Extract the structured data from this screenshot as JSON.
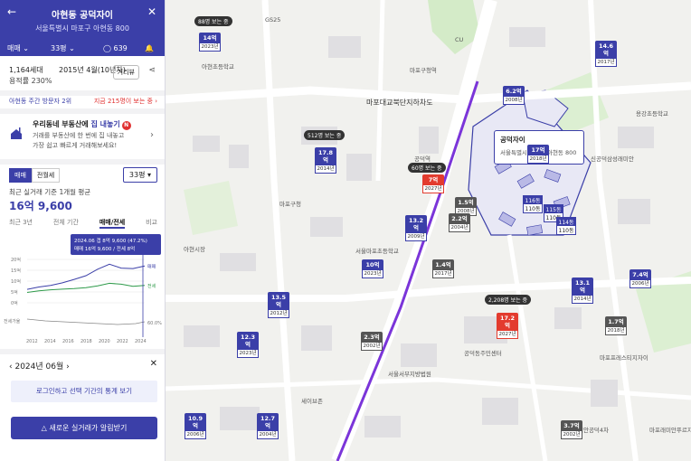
{
  "header": {
    "title": "아현동 공덕자이",
    "address": "서울특별시 마포구 아현동 800",
    "trade_type": "매매",
    "area": "33평",
    "comments": "639"
  },
  "summary": {
    "households": "1,164세대",
    "built": "2015년 4월(10년차)",
    "far": "용적률 230%",
    "distance_btn": "거리뷰"
  },
  "rank": {
    "left": "아현동 주간 방문자 2위",
    "right": "지금 215명이 보는 중 ›"
  },
  "promo": {
    "title_prefix": "우리동네 부동산에 ",
    "title_accent": "집 내놓기",
    "badge": "N",
    "line1": "거래를 부동산에 한 번에 집 내놓고",
    "line2": "가장 쉽고 빠르게 거래해보세요!"
  },
  "trade_tabs": [
    "매매",
    "전월세"
  ],
  "area_select": "33평 ▾",
  "avg_label": "최근 실거래 기준 1개월 평균",
  "avg_price": "16억 9,600",
  "period_tabs": [
    "최근 3년",
    "전체 기간",
    "매매/전세",
    "비교"
  ],
  "chart_data": {
    "type": "line",
    "tooltip_line1": "2024.06 갭 8억 9,600 (47.2%)",
    "tooltip_line2": "매매 16억 9,600 / 전세 8억",
    "y_ticks": [
      "20억",
      "15억",
      "10억",
      "5억",
      "0억"
    ],
    "volume_label": "전세가율",
    "x_ticks": [
      "2012",
      "2014",
      "2016",
      "2018",
      "2020",
      "2022",
      "2024"
    ],
    "series": [
      {
        "name": "매매",
        "values": [
          6.2,
          7.3,
          8.0,
          9.2,
          10.8,
          12.5,
          15.5,
          17.8,
          16.0,
          15.8,
          16.96
        ],
        "color": "#3b3fa8"
      },
      {
        "name": "전세",
        "values": [
          4.8,
          5.5,
          6.0,
          6.3,
          6.6,
          7.0,
          7.8,
          9.0,
          8.6,
          7.6,
          8.0
        ],
        "color": "#2e9a4a"
      }
    ],
    "ratio_label": "60.0%"
  },
  "month_nav": {
    "label": "2024년 06월",
    "prev": "‹",
    "next": "›",
    "close": "✕"
  },
  "login_text": "로그인하고 선택 기간의 통계 보기",
  "cta": "새로운 실거래가 알림받기",
  "map": {
    "main_card": {
      "name": "공덕자이",
      "address": "서울특별시 마포구 아현동 800"
    },
    "road_label": "마포대교북단지하차도",
    "labels": [
      "아현초등학교",
      "마포대교입구광장",
      "공덕역",
      "마포구청",
      "CU",
      "GS25",
      "서울마포초등학교",
      "아현시장",
      "마포구청역",
      "세이브존",
      "서울서부지방법원",
      "공덕동주민센터",
      "마포프레스티지자이",
      "래미안공덕4차",
      "마포래미안푸르지오",
      "신공덕삼성래미안",
      "용강초등학교",
      "공덕파크자이",
      "서울시립마포청소년센터"
    ],
    "pins": [
      {
        "price": "14억",
        "year": "2023년"
      },
      {
        "price": "6.2억",
        "year": "2008년"
      },
      {
        "price": "14.6억",
        "year": "2017년"
      },
      {
        "price": "17.8억",
        "year": "2014년"
      },
      {
        "price": "7억",
        "year": "2027년"
      },
      {
        "price": "1.5억",
        "year": "2008년"
      },
      {
        "price": "2.2억",
        "year": "2004년"
      },
      {
        "price": "13.2억",
        "year": "2009년"
      },
      {
        "price": "10억",
        "year": "2023년"
      },
      {
        "price": "1.4억",
        "year": "2017년"
      },
      {
        "price": "17억",
        "year": "2018년"
      },
      {
        "price": "13.5억",
        "year": "2012년"
      },
      {
        "price": "12.3억",
        "year": "2023년"
      },
      {
        "price": "17.2억",
        "year": "2027년"
      },
      {
        "price": "2.3억",
        "year": "2002년"
      },
      {
        "price": "13.1억",
        "year": "2014년"
      },
      {
        "price": "7.4억",
        "year": "2006년"
      },
      {
        "price": "1.7억",
        "year": "2018년"
      },
      {
        "price": "10.9억",
        "year": "2006년"
      },
      {
        "price": "12.7억",
        "year": "2004년"
      },
      {
        "price": "3.7억",
        "year": "2002년"
      }
    ],
    "bubbles": [
      "88명 보는 중",
      "512명 보는 중",
      "60명 보는 중",
      "2,208명 보는 중"
    ],
    "buildings": [
      {
        "dong": "116동",
        "v": "110동"
      },
      {
        "dong": "115동",
        "v": "110동"
      },
      {
        "dong": "114동",
        "v": "110동"
      }
    ]
  }
}
